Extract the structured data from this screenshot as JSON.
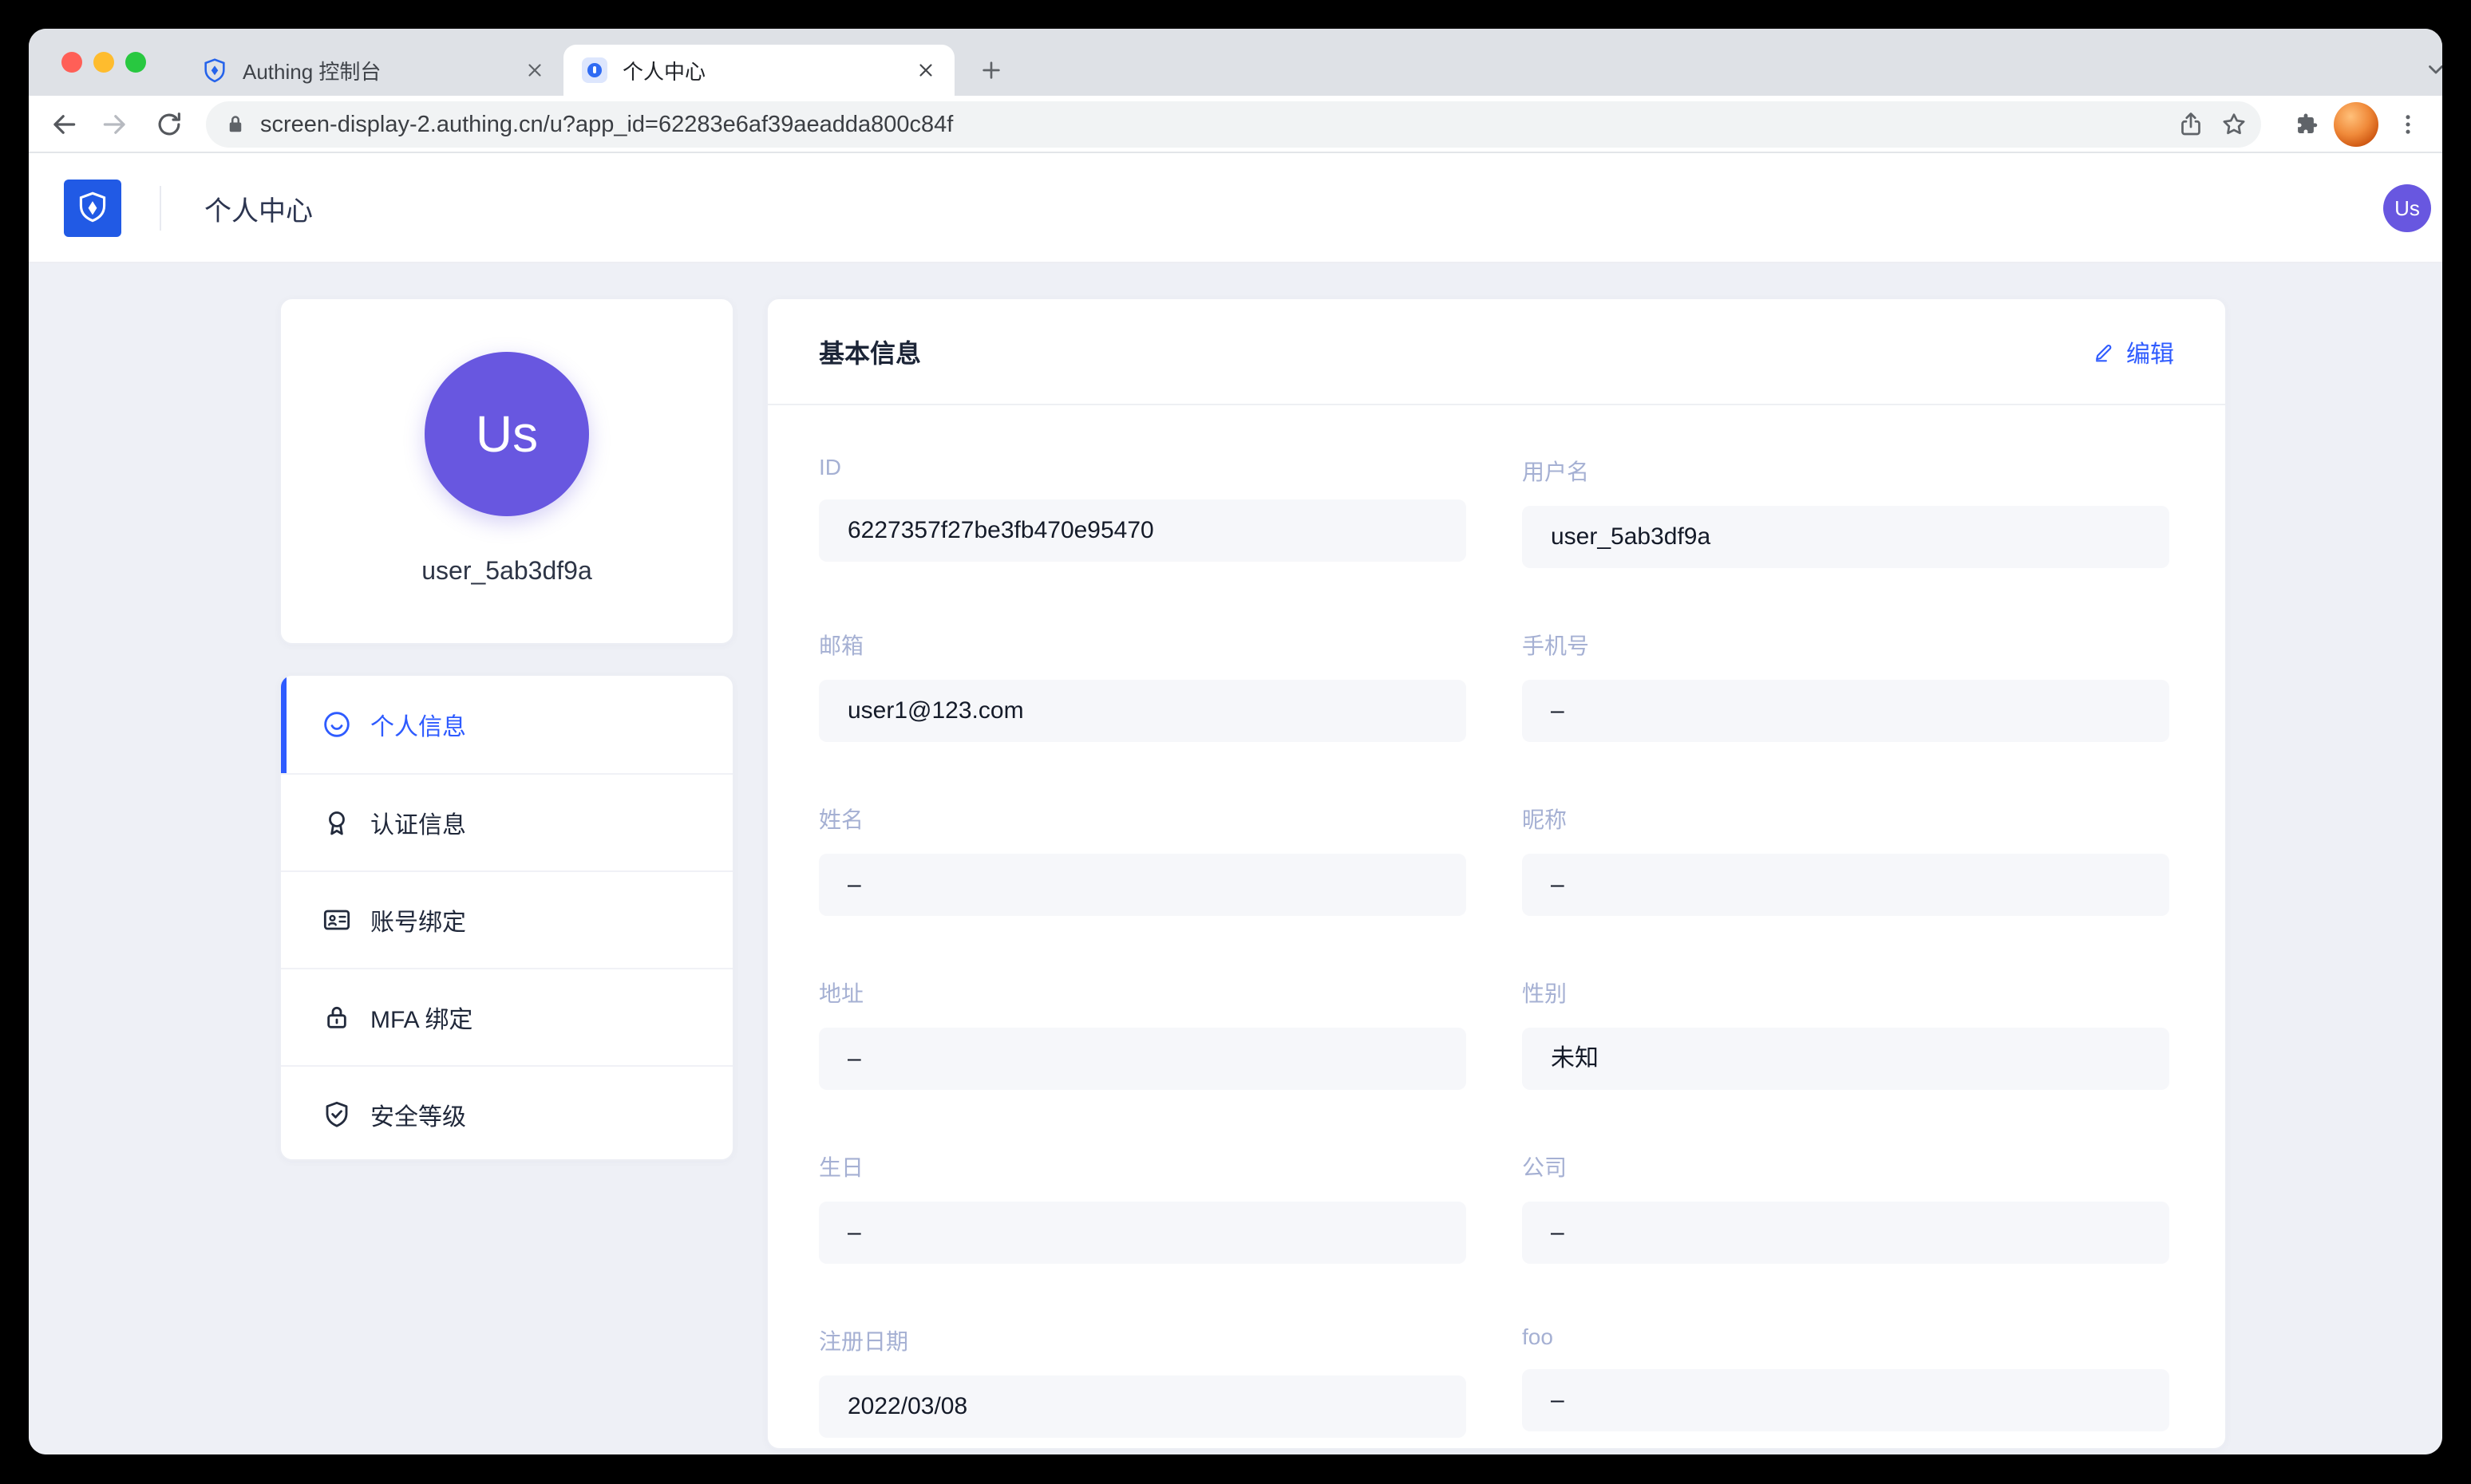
{
  "browser": {
    "tabs": [
      {
        "label": "Authing 控制台",
        "favicon": "authing-shield-icon",
        "active": false
      },
      {
        "label": "个人中心",
        "favicon": "user-center-icon",
        "active": true
      }
    ],
    "url": "screen-display-2.authing.cn/u?app_id=62283e6af39aeadda800c84f",
    "toolbar_icons": [
      "back-icon",
      "forward-icon",
      "reload-icon",
      "lock-icon",
      "share-icon",
      "bookmark-star-icon",
      "extensions-puzzle-icon",
      "profile-avatar",
      "menu-dots-icon",
      "new-tab-plus-icon",
      "tabstrip-chevron-icon"
    ]
  },
  "header": {
    "title": "个人中心",
    "avatar_initials": "Us"
  },
  "profile_card": {
    "avatar_initials": "Us",
    "username": "user_5ab3df9a"
  },
  "menu": {
    "items": [
      {
        "label": "个人信息",
        "icon": "smile-icon",
        "active": true
      },
      {
        "label": "认证信息",
        "icon": "medal-icon",
        "active": false
      },
      {
        "label": "账号绑定",
        "icon": "id-card-icon",
        "active": false
      },
      {
        "label": "MFA 绑定",
        "icon": "lock-icon",
        "active": false
      },
      {
        "label": "安全等级",
        "icon": "shield-check-icon",
        "active": false
      }
    ]
  },
  "panel": {
    "title": "基本信息",
    "edit_label": "编辑",
    "fields": [
      {
        "label": "ID",
        "value": "6227357f27be3fb470e95470"
      },
      {
        "label": "用户名",
        "value": "user_5ab3df9a"
      },
      {
        "label": "邮箱",
        "value": "user1@123.com"
      },
      {
        "label": "手机号",
        "value": "–"
      },
      {
        "label": "姓名",
        "value": "–"
      },
      {
        "label": "昵称",
        "value": "–"
      },
      {
        "label": "地址",
        "value": "–"
      },
      {
        "label": "性别",
        "value": "未知"
      },
      {
        "label": "生日",
        "value": "–"
      },
      {
        "label": "公司",
        "value": "–"
      },
      {
        "label": "注册日期",
        "value": "2022/03/08"
      },
      {
        "label": "foo",
        "value": "–"
      }
    ]
  },
  "colors": {
    "accent_blue": "#2e5bff",
    "brand_blue": "#215ae5",
    "avatar_purple": "#6857e0",
    "content_bg": "#eef0f6",
    "tabstrip_bg": "#dee1e6"
  }
}
